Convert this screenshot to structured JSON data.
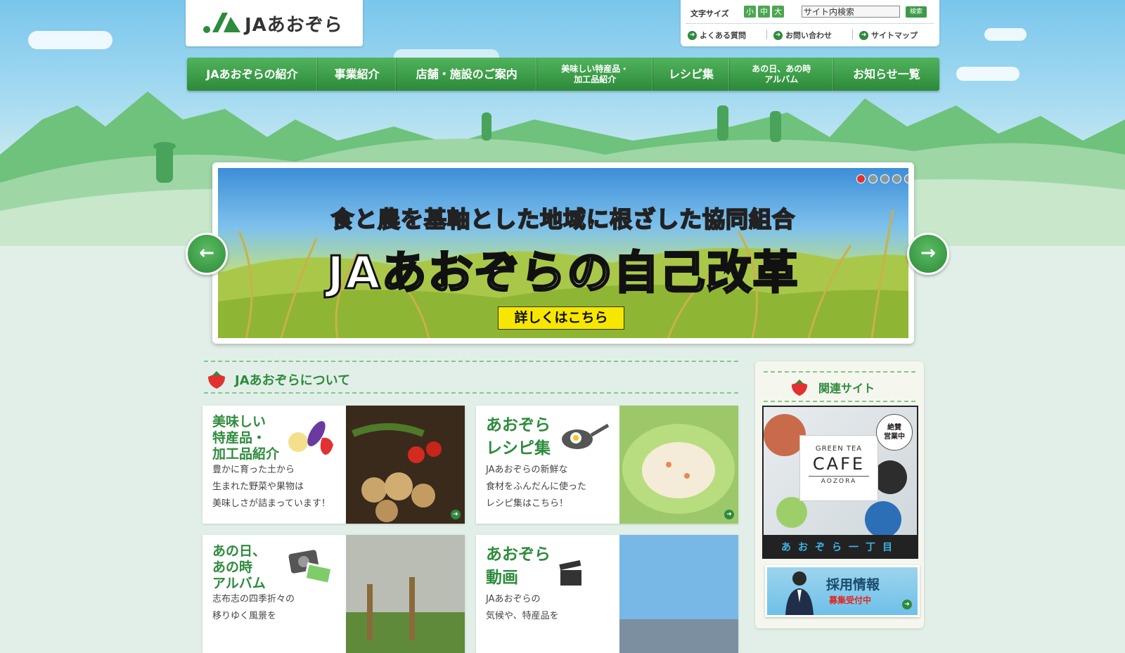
{
  "header": {
    "logo_text": "JAあおぞら",
    "font_size": {
      "label": "文字サイズ",
      "options": [
        "小",
        "中",
        "大"
      ]
    },
    "search": {
      "value": "サイト内検索",
      "button_label": "検索"
    },
    "util_links": [
      "よくある質問",
      "お問い合わせ",
      "サイトマップ"
    ]
  },
  "nav": {
    "items": [
      "JAあおぞらの紹介",
      "事業紹介",
      "店舗・施設のご案内",
      "美味しい特産品・\n加工品紹介",
      "レシピ集",
      "あの日、あの時\nアルバム",
      "お知らせ一覧"
    ]
  },
  "hero": {
    "line1": "食と農を基軸とした地域に根ざした協同組合",
    "line2": "JAあおぞらの自己改革",
    "cta": "詳しくはこちら",
    "prev": "←",
    "next": "→"
  },
  "about": {
    "heading": "JAあおぞらについて",
    "cards": [
      {
        "title": "美味しい\n特産品・\n加工品紹介",
        "desc": "豊かに育った土から\n生まれた野菜や果物は\n美味しさが詰まっています！"
      },
      {
        "title": "あおぞら\nレシピ集",
        "desc": "JAあおぞらの新鮮な\n食材をふんだんに使った\nレシピ集はこちら！"
      },
      {
        "title": "あの日、\nあの時\nアルバム",
        "desc": "志布志の四季折々の\n移りゆく風景を"
      },
      {
        "title": "あおぞら\n動画",
        "desc": "JAあおぞらの\n気候や、特産品を"
      }
    ]
  },
  "sidebar": {
    "heading": "関連サイト",
    "cafe": {
      "small": "GREEN TEA",
      "big": "CAFE",
      "sub": "AOZORA",
      "badge": "絶賛\n営業中",
      "footer": "あおぞら一丁目"
    },
    "recruit": {
      "title": "採用情報",
      "sub": "募集受付中"
    }
  },
  "colors": {
    "brand_green": "#2e8b3d",
    "cta_yellow": "#f7e600",
    "active_dot": "#e23131"
  }
}
